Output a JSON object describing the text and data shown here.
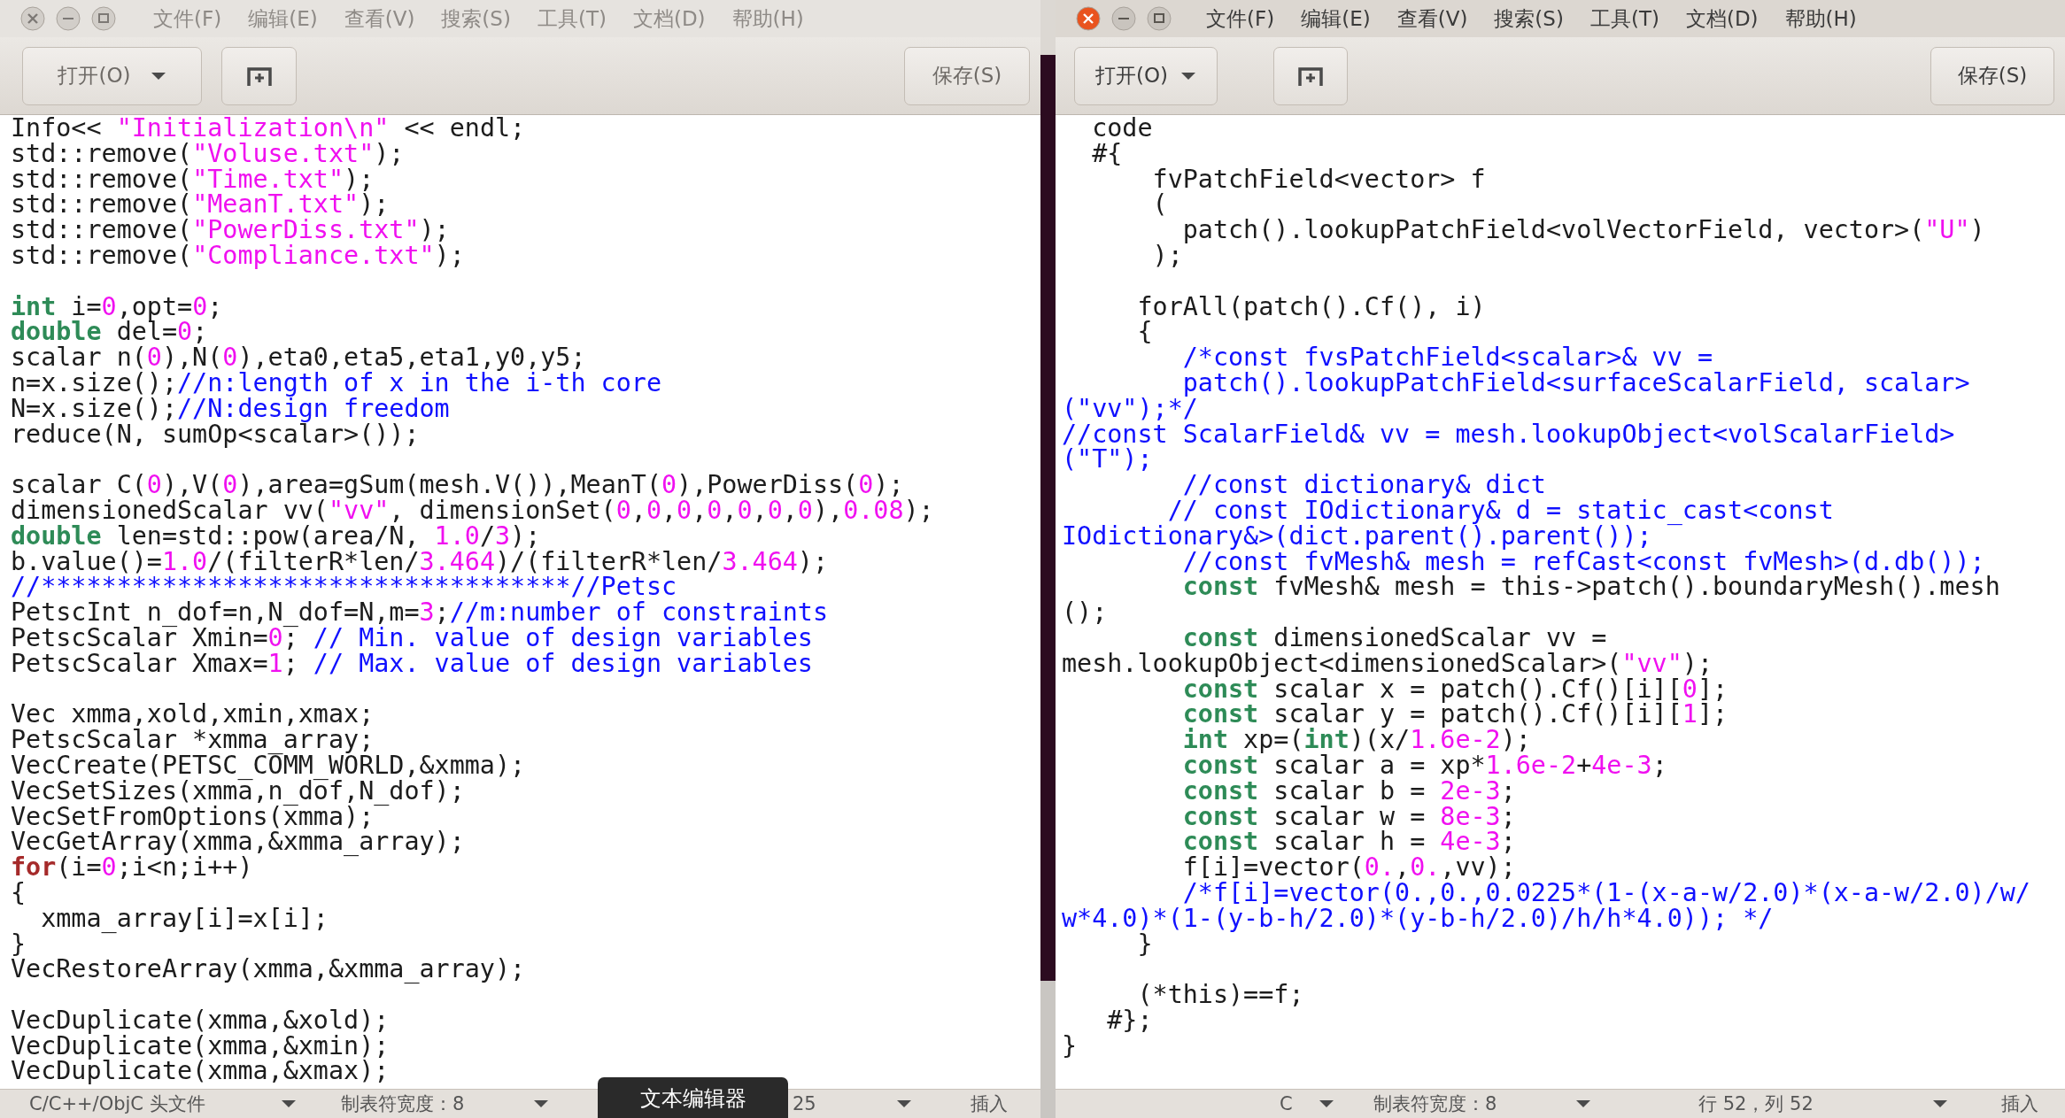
{
  "windows": [
    {
      "active": false,
      "menu": [
        "文件(F)",
        "编辑(E)",
        "查看(V)",
        "搜索(S)",
        "工具(T)",
        "文档(D)",
        "帮助(H)"
      ],
      "open_button": "打开(O)",
      "save_button": "保存(S)",
      "code_blocks": [
        [
          [
            {
              "kind": "plain",
              "text": "Info<< "
            },
            {
              "kind": "string",
              "text": "\"Initialization\\n\""
            },
            {
              "kind": "plain",
              "text": " << endl;"
            }
          ],
          [
            {
              "kind": "plain",
              "text": "std::remove("
            },
            {
              "kind": "string",
              "text": "\"Voluse.txt\""
            },
            {
              "kind": "plain",
              "text": ");"
            }
          ],
          [
            {
              "kind": "plain",
              "text": "std::remove("
            },
            {
              "kind": "string",
              "text": "\"Time.txt\""
            },
            {
              "kind": "plain",
              "text": ");"
            }
          ],
          [
            {
              "kind": "plain",
              "text": "std::remove("
            },
            {
              "kind": "string",
              "text": "\"MeanT.txt\""
            },
            {
              "kind": "plain",
              "text": ");"
            }
          ],
          [
            {
              "kind": "plain",
              "text": "std::remove("
            },
            {
              "kind": "string",
              "text": "\"PowerDiss.txt\""
            },
            {
              "kind": "plain",
              "text": ");"
            }
          ],
          [
            {
              "kind": "plain",
              "text": "std::remove("
            },
            {
              "kind": "string",
              "text": "\"Compliance.txt\""
            },
            {
              "kind": "plain",
              "text": ");"
            }
          ]
        ],
        [
          [
            {
              "kind": "keyword",
              "text": "int"
            },
            {
              "kind": "plain",
              "text": " i="
            },
            {
              "kind": "number",
              "text": "0"
            },
            {
              "kind": "plain",
              "text": ",opt="
            },
            {
              "kind": "number",
              "text": "0"
            },
            {
              "kind": "plain",
              "text": ";"
            }
          ],
          [
            {
              "kind": "keyword",
              "text": "double"
            },
            {
              "kind": "plain",
              "text": " del="
            },
            {
              "kind": "number",
              "text": "0"
            },
            {
              "kind": "plain",
              "text": ";"
            }
          ],
          [
            {
              "kind": "plain",
              "text": "scalar n("
            },
            {
              "kind": "number",
              "text": "0"
            },
            {
              "kind": "plain",
              "text": "),N("
            },
            {
              "kind": "number",
              "text": "0"
            },
            {
              "kind": "plain",
              "text": "),eta0,eta5,eta1,y0,y5;"
            }
          ],
          [
            {
              "kind": "plain",
              "text": "n=x.size();"
            },
            {
              "kind": "comment",
              "text": "//n:length of x in the i-th core"
            }
          ],
          [
            {
              "kind": "plain",
              "text": "N=x.size();"
            },
            {
              "kind": "comment",
              "text": "//N:design freedom"
            }
          ],
          [
            {
              "kind": "plain",
              "text": "reduce(N, sumOp<scalar>());"
            }
          ]
        ],
        [
          [
            {
              "kind": "plain",
              "text": "scalar C("
            },
            {
              "kind": "number",
              "text": "0"
            },
            {
              "kind": "plain",
              "text": "),V("
            },
            {
              "kind": "number",
              "text": "0"
            },
            {
              "kind": "plain",
              "text": "),area=gSum(mesh.V()),MeanT("
            },
            {
              "kind": "number",
              "text": "0"
            },
            {
              "kind": "plain",
              "text": "),PowerDiss("
            },
            {
              "kind": "number",
              "text": "0"
            },
            {
              "kind": "plain",
              "text": ");"
            }
          ],
          [
            {
              "kind": "plain",
              "text": "dimensionedScalar vv("
            },
            {
              "kind": "string",
              "text": "\"vv\""
            },
            {
              "kind": "plain",
              "text": ", dimensionSet("
            },
            {
              "kind": "number",
              "text": "0"
            },
            {
              "kind": "plain",
              "text": ","
            },
            {
              "kind": "number",
              "text": "0"
            },
            {
              "kind": "plain",
              "text": ","
            },
            {
              "kind": "number",
              "text": "0"
            },
            {
              "kind": "plain",
              "text": ","
            },
            {
              "kind": "number",
              "text": "0"
            },
            {
              "kind": "plain",
              "text": ","
            },
            {
              "kind": "number",
              "text": "0"
            },
            {
              "kind": "plain",
              "text": ","
            },
            {
              "kind": "number",
              "text": "0"
            },
            {
              "kind": "plain",
              "text": ","
            },
            {
              "kind": "number",
              "text": "0"
            },
            {
              "kind": "plain",
              "text": "),"
            },
            {
              "kind": "number",
              "text": "0.08"
            },
            {
              "kind": "plain",
              "text": ");"
            }
          ],
          [
            {
              "kind": "keyword",
              "text": "double"
            },
            {
              "kind": "plain",
              "text": " len=std::pow(area/N, "
            },
            {
              "kind": "number",
              "text": "1.0"
            },
            {
              "kind": "plain",
              "text": "/"
            },
            {
              "kind": "number",
              "text": "3"
            },
            {
              "kind": "plain",
              "text": ");"
            }
          ],
          [
            {
              "kind": "plain",
              "text": "b.value()="
            },
            {
              "kind": "number",
              "text": "1.0"
            },
            {
              "kind": "plain",
              "text": "/(filterR*len/"
            },
            {
              "kind": "number",
              "text": "3.464"
            },
            {
              "kind": "plain",
              "text": ")/(filterR*len/"
            },
            {
              "kind": "number",
              "text": "3.464"
            },
            {
              "kind": "plain",
              "text": ");"
            }
          ],
          [
            {
              "kind": "comment",
              "text": "//***********************************//Petsc"
            }
          ],
          [
            {
              "kind": "plain",
              "text": "PetscInt n_dof=n,N_dof=N,m="
            },
            {
              "kind": "number",
              "text": "3"
            },
            {
              "kind": "plain",
              "text": ";"
            },
            {
              "kind": "comment",
              "text": "//m:number of constraints"
            }
          ],
          [
            {
              "kind": "plain",
              "text": "PetscScalar Xmin="
            },
            {
              "kind": "number",
              "text": "0"
            },
            {
              "kind": "plain",
              "text": "; "
            },
            {
              "kind": "comment",
              "text": "// Min. value of design variables"
            }
          ],
          [
            {
              "kind": "plain",
              "text": "PetscScalar Xmax="
            },
            {
              "kind": "number",
              "text": "1"
            },
            {
              "kind": "plain",
              "text": "; "
            },
            {
              "kind": "comment",
              "text": "// Max. value of design variables"
            }
          ]
        ],
        [
          [
            {
              "kind": "plain",
              "text": "Vec xmma,xold,xmin,xmax;"
            }
          ],
          [
            {
              "kind": "plain",
              "text": "PetscScalar *xmma_array;"
            }
          ],
          [
            {
              "kind": "plain",
              "text": "VecCreate(PETSC_COMM_WORLD,&xmma);"
            }
          ],
          [
            {
              "kind": "plain",
              "text": "VecSetSizes(xmma,n_dof,N_dof);"
            }
          ],
          [
            {
              "kind": "plain",
              "text": "VecSetFromOptions(xmma);"
            }
          ],
          [
            {
              "kind": "plain",
              "text": "VecGetArray(xmma,&xmma_array);"
            }
          ],
          [
            {
              "kind": "control",
              "text": "for"
            },
            {
              "kind": "plain",
              "text": "(i="
            },
            {
              "kind": "number",
              "text": "0"
            },
            {
              "kind": "plain",
              "text": ";i<n;i++)"
            }
          ],
          [
            {
              "kind": "plain",
              "text": "{"
            }
          ],
          [
            {
              "kind": "plain",
              "text": "  xmma_array[i]=x[i];"
            }
          ],
          [
            {
              "kind": "plain",
              "text": "}"
            }
          ],
          [
            {
              "kind": "plain",
              "text": "VecRestoreArray(xmma,&xmma_array);"
            }
          ]
        ],
        [
          [
            {
              "kind": "plain",
              "text": "VecDuplicate(xmma,&xold);"
            }
          ],
          [
            {
              "kind": "plain",
              "text": "VecDuplicate(xmma,&xmin);"
            }
          ],
          [
            {
              "kind": "plain",
              "text": "VecDuplicate(xmma,&xmax);"
            }
          ]
        ]
      ],
      "status_bar": [
        {
          "kind": "dropdown",
          "text": "C/C++/ObjC 头文件"
        },
        {
          "kind": "dropdown",
          "text": "制表符宽度：8"
        },
        {
          "kind": "dropdown",
          "text": "25"
        },
        {
          "kind": "label",
          "text": "插入"
        }
      ]
    },
    {
      "active": true,
      "menu": [
        "文件(F)",
        "编辑(E)",
        "查看(V)",
        "搜索(S)",
        "工具(T)",
        "文档(D)",
        "帮助(H)"
      ],
      "open_button": "打开(O)",
      "save_button": "保存(S)",
      "code_blocks": [
        [
          [
            {
              "kind": "plain",
              "text": "  code"
            }
          ],
          [
            {
              "kind": "plain",
              "text": "  #{"
            }
          ],
          [
            {
              "kind": "plain",
              "text": "      fvPatchField<vector> f"
            }
          ],
          [
            {
              "kind": "plain",
              "text": "      ("
            }
          ],
          [
            {
              "kind": "plain",
              "text": "        patch().lookupPatchField<volVectorField, vector>("
            },
            {
              "kind": "string",
              "text": "\"U\""
            },
            {
              "kind": "plain",
              "text": ")"
            }
          ],
          [
            {
              "kind": "plain",
              "text": "      );"
            }
          ]
        ],
        [
          [
            {
              "kind": "plain",
              "text": "     forAll(patch().Cf(), i)"
            }
          ],
          [
            {
              "kind": "plain",
              "text": "     {"
            }
          ],
          [
            {
              "kind": "comment",
              "text": "        /*const fvsPatchField<scalar>& vv ="
            }
          ],
          [
            {
              "kind": "comment",
              "text": "        patch().lookupPatchField<surfaceScalarField, scalar>"
            }
          ],
          [
            {
              "kind": "comment",
              "text": "(\"vv\");*/"
            }
          ],
          [
            {
              "kind": "comment",
              "text": "//const ScalarField& vv = mesh.lookupObject<volScalarField>"
            }
          ],
          [
            {
              "kind": "comment",
              "text": "(\"T\");"
            }
          ],
          [
            {
              "kind": "comment",
              "text": "        //const dictionary& dict"
            }
          ],
          [
            {
              "kind": "comment",
              "text": "       // const IOdictionary& d = static_cast<const"
            }
          ],
          [
            {
              "kind": "comment",
              "text": "IOdictionary&>(dict.parent().parent());"
            }
          ],
          [
            {
              "kind": "comment",
              "text": "        //const fvMesh& mesh = refCast<const fvMesh>(d.db());"
            }
          ],
          [
            {
              "kind": "indented_keyword",
              "text": "const"
            },
            {
              "kind": "plain",
              "text": " fvMesh& mesh = this->patch().boundaryMesh().mesh"
            }
          ],
          [
            {
              "kind": "plain",
              "text": "();"
            }
          ],
          [
            {
              "kind": "indented_keyword",
              "text": "const"
            },
            {
              "kind": "plain",
              "text": " dimensionedScalar vv ="
            }
          ],
          [
            {
              "kind": "plain",
              "text": "mesh.lookupObject<dimensionedScalar>("
            },
            {
              "kind": "string",
              "text": "\"vv\""
            },
            {
              "kind": "plain",
              "text": ");"
            }
          ],
          [
            {
              "kind": "indented_keyword",
              "text": "const"
            },
            {
              "kind": "plain",
              "text": " scalar x = patch().Cf()[i]["
            },
            {
              "kind": "number",
              "text": "0"
            },
            {
              "kind": "plain",
              "text": "];"
            }
          ],
          [
            {
              "kind": "indented_keyword",
              "text": "const"
            },
            {
              "kind": "plain",
              "text": " scalar y = patch().Cf()[i]["
            },
            {
              "kind": "number",
              "text": "1"
            },
            {
              "kind": "plain",
              "text": "];"
            }
          ],
          [
            {
              "kind": "indented_keyword",
              "text": "int"
            },
            {
              "kind": "plain",
              "text": " xp=("
            },
            {
              "kind": "keyword",
              "text": "int"
            },
            {
              "kind": "plain",
              "text": ")(x/"
            },
            {
              "kind": "number",
              "text": "1.6e-2"
            },
            {
              "kind": "plain",
              "text": ");"
            }
          ],
          [
            {
              "kind": "indented_keyword",
              "text": "const"
            },
            {
              "kind": "plain",
              "text": " scalar a = xp*"
            },
            {
              "kind": "number",
              "text": "1.6e-2"
            },
            {
              "kind": "plain",
              "text": "+"
            },
            {
              "kind": "number",
              "text": "4e-3"
            },
            {
              "kind": "plain",
              "text": ";"
            }
          ],
          [
            {
              "kind": "indented_keyword",
              "text": "const"
            },
            {
              "kind": "plain",
              "text": " scalar b = "
            },
            {
              "kind": "number",
              "text": "2e-3"
            },
            {
              "kind": "plain",
              "text": ";"
            }
          ],
          [
            {
              "kind": "indented_keyword",
              "text": "const"
            },
            {
              "kind": "plain",
              "text": " scalar w = "
            },
            {
              "kind": "number",
              "text": "8e-3"
            },
            {
              "kind": "plain",
              "text": ";"
            }
          ],
          [
            {
              "kind": "indented_keyword",
              "text": "const"
            },
            {
              "kind": "plain",
              "text": " scalar h = "
            },
            {
              "kind": "number",
              "text": "4e-3"
            },
            {
              "kind": "plain",
              "text": ";"
            }
          ],
          [
            {
              "kind": "plain",
              "text": "        f[i]=vector("
            },
            {
              "kind": "number",
              "text": "0."
            },
            {
              "kind": "plain",
              "text": ","
            },
            {
              "kind": "number",
              "text": "0."
            },
            {
              "kind": "plain",
              "text": ",vv);"
            }
          ],
          [
            {
              "kind": "comment",
              "text": "        /*f[i]=vector(0.,0.,0.0225*(1-(x-a-w/2.0)*(x-a-w/2.0)/w/"
            }
          ],
          [
            {
              "kind": "comment",
              "text": "w*4.0)*(1-(y-b-h/2.0)*(y-b-h/2.0)/h/h*4.0)); */"
            }
          ],
          [
            {
              "kind": "plain",
              "text": "     }"
            }
          ]
        ],
        [
          [
            {
              "kind": "plain",
              "text": "     (*this)==f;"
            }
          ],
          [
            {
              "kind": "plain",
              "text": "   #};"
            }
          ],
          [
            {
              "kind": "plain",
              "text": "}"
            }
          ]
        ]
      ],
      "status_bar": [
        {
          "kind": "dropdown",
          "text": "C"
        },
        {
          "kind": "dropdown",
          "text": "制表符宽度：8"
        },
        {
          "kind": "dropdown",
          "text": "行 52，列 52"
        },
        {
          "kind": "label",
          "text": "插入"
        }
      ]
    }
  ],
  "tooltip": "文本编辑器"
}
